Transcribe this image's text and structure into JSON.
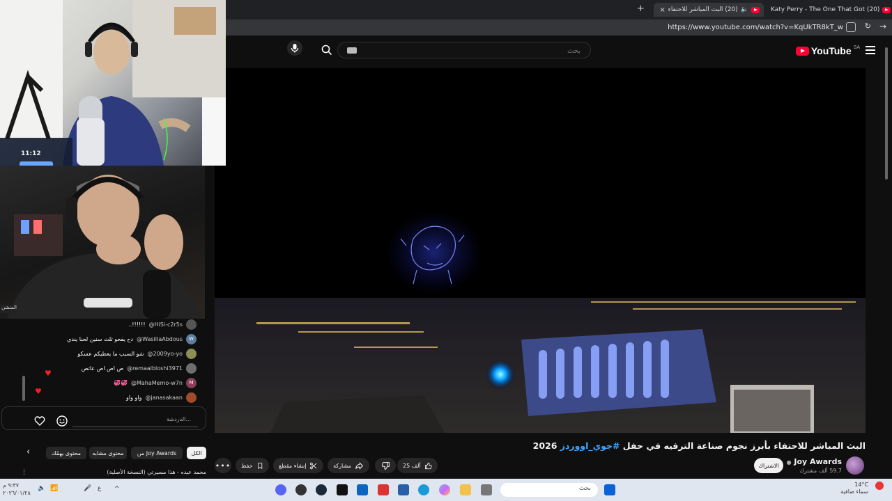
{
  "browser": {
    "tabs": [
      {
        "title": "(20) Katy Perry - The One That Got"
      },
      {
        "title": "(20) البث المباشر للاحتفاء بأبرز"
      }
    ],
    "url": "https://www.youtube.com/watch?v=KqUkTR8kT_w"
  },
  "header": {
    "logo": "YouTube",
    "region": "SA",
    "search_placeholder": "بحث"
  },
  "video": {
    "title_prefix": "البث المباشر للاحتفاء بأبرز نجوم صناعة الترفيه في حفل ",
    "hashtag": "#جوي_اووردز",
    "title_suffix": " 2026",
    "channel": "Joy Awards",
    "subscribers": "59.7 ألف مشترك",
    "join_label": "الاشتراك",
    "likes": "25 ألف",
    "share_label": "مشاركة",
    "clip_label": "إنشاء مقطع",
    "save_label": "حفظ"
  },
  "chat": {
    "messages": [
      {
        "user": "@HiSi-c2r5s",
        "text": "..!!!!!!",
        "color": "#777"
      },
      {
        "user": "@WasilIaAbdous",
        "text": "دح يفحو ثلث سنين لحنا يندي",
        "initial": "W",
        "color": "#5b7ea0"
      },
      {
        "user": "@2009yo-yo",
        "text": "شو السبب ما يعطيكم عسكو",
        "color": "#8c8f55"
      },
      {
        "user": "@remaalbloshi3971",
        "text": "ص اص اص عاتص",
        "color": "#6e6e6e"
      },
      {
        "user": "@MahaMemo-w7n",
        "text": "💞💞",
        "initial": "M",
        "color": "#8a3f5a"
      },
      {
        "user": "@janasakaan",
        "text": "واو واو",
        "color": "#a14b2a"
      }
    ],
    "input_placeholder": "الدردشة..."
  },
  "chips": {
    "all": "الكل",
    "from_channel": "من Joy Awards",
    "related": "محتوى مشابه",
    "for_you": "محتوى يهمّك"
  },
  "recommendation_preview": "محمد عبده - هذا مسيرتي (النسخة الأصلية)",
  "taskbar": {
    "search_placeholder": "بحث",
    "time": "٩:٣٧ م",
    "date": "٢٠٢٦/٠١/٢٨",
    "temperature": "14°C",
    "weather": "سماء صافية"
  },
  "overlay": {
    "cam_badge_time": "11:12",
    "cam_label": "المنشن"
  }
}
